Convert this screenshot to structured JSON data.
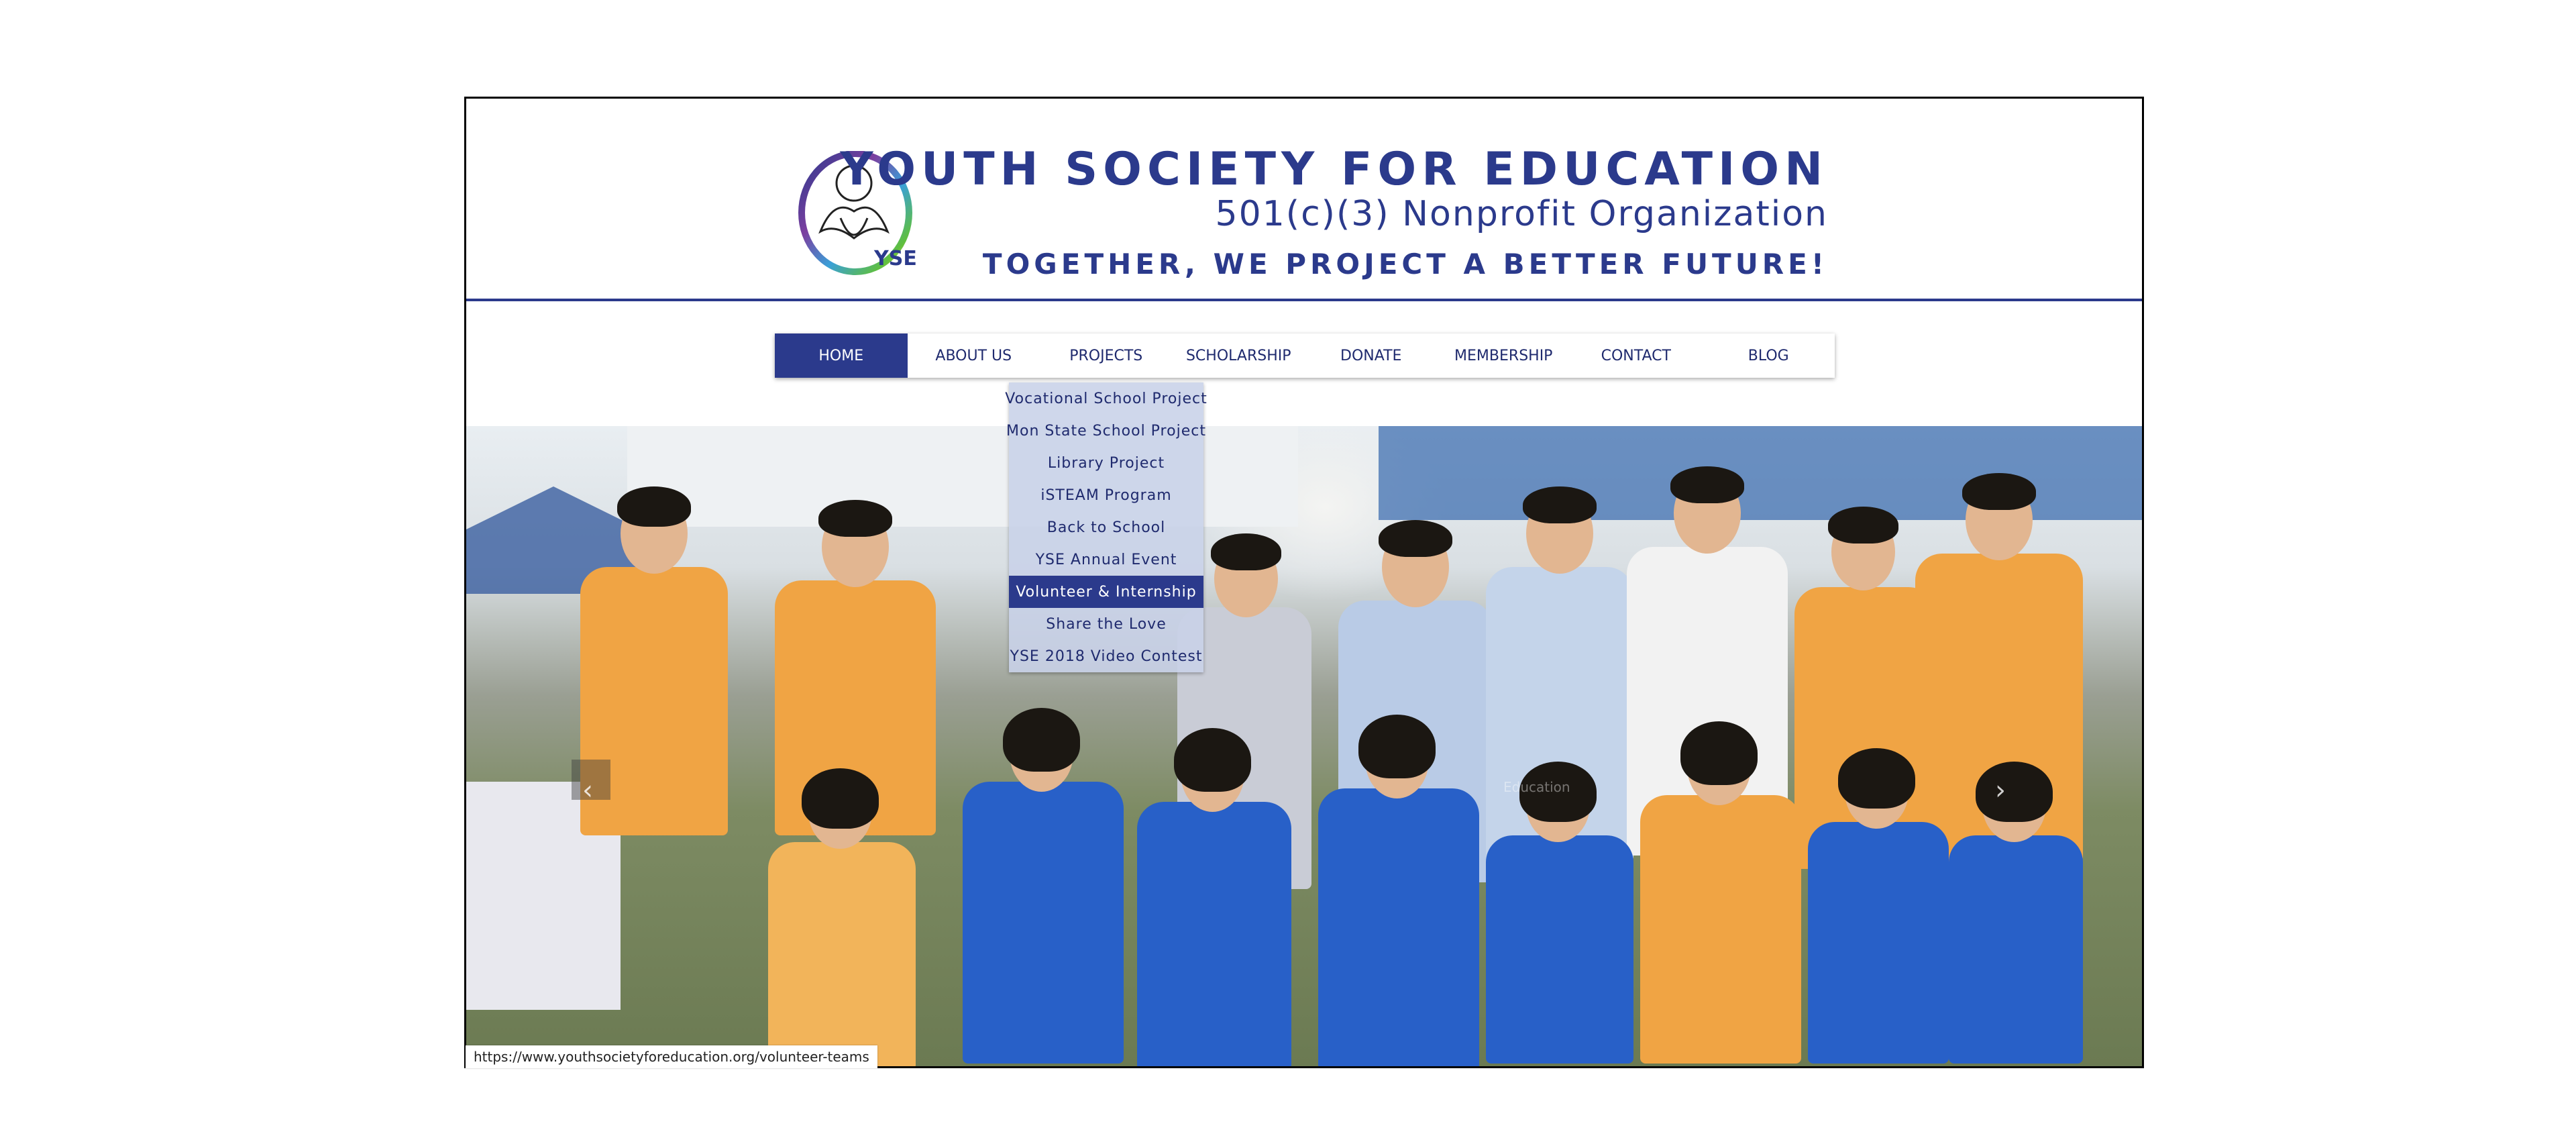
{
  "header": {
    "title": "YOUTH SOCIETY FOR EDUCATION",
    "subtitle": "501(c)(3) Nonprofit Organization",
    "tagline": "TOGETHER, WE PROJECT A BETTER FUTURE!",
    "logo_text": "YSE"
  },
  "nav": {
    "items": [
      {
        "label": "HOME"
      },
      {
        "label": "ABOUT US"
      },
      {
        "label": "PROJECTS"
      },
      {
        "label": "SCHOLARSHIP"
      },
      {
        "label": "DONATE"
      },
      {
        "label": "MEMBERSHIP"
      },
      {
        "label": "CONTACT"
      },
      {
        "label": "BLOG"
      }
    ],
    "active": "HOME"
  },
  "projects_dropdown": {
    "items": [
      {
        "label": "Vocational School Project"
      },
      {
        "label": "Mon State School Project"
      },
      {
        "label": "Library Project"
      },
      {
        "label": "iSTEAM Program"
      },
      {
        "label": "Back to School"
      },
      {
        "label": "YSE Annual Event"
      },
      {
        "label": "Volunteer & Internship"
      },
      {
        "label": "Share the Love"
      },
      {
        "label": "YSE 2018 Video Contest"
      }
    ],
    "hovered": "Volunteer & Internship"
  },
  "slideshow": {
    "prev_icon": "chevron-left-icon",
    "next_icon": "chevron-right-icon",
    "prev_glyph": "‹",
    "next_glyph": "›"
  },
  "status_bar": {
    "url": "https://www.youthsocietyforeducation.org/volunteer-teams"
  },
  "colors": {
    "brand_blue": "#2b3a8c",
    "nav_text": "#1f2a6e",
    "orange_shirt": "#f0a444",
    "blue_hoodie": "#2860c8"
  }
}
